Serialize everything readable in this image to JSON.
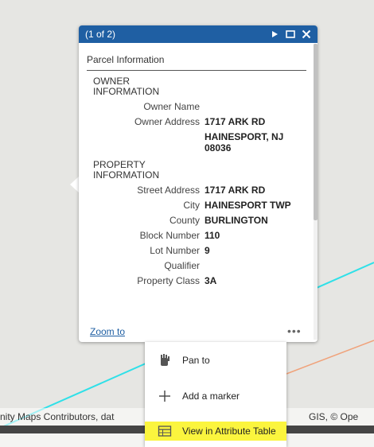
{
  "popup": {
    "counter": "(1 of 2)",
    "title": "Parcel Information",
    "sections": [
      {
        "heading": "OWNER INFORMATION",
        "rows": [
          {
            "label": "Owner Name",
            "value": ""
          },
          {
            "label": "Owner Address",
            "value": "1717 ARK RD"
          },
          {
            "label": "",
            "value": "HAINESPORT, NJ 08036"
          }
        ]
      },
      {
        "heading": "PROPERTY INFORMATION",
        "rows": [
          {
            "label": "Street Address",
            "value": "1717 ARK RD"
          },
          {
            "label": "City",
            "value": "HAINESPORT TWP"
          },
          {
            "label": "County",
            "value": "BURLINGTON"
          },
          {
            "label": "Block Number",
            "value": "110"
          },
          {
            "label": "Lot Number",
            "value": "9"
          },
          {
            "label": "Qualifier",
            "value": ""
          },
          {
            "label": "Property Class",
            "value": "3A"
          }
        ]
      }
    ],
    "zoom_link": "Zoom to",
    "more_label": "•••",
    "buttons": {
      "next": "next-icon",
      "maximize": "maximize-icon",
      "close": "close-icon"
    }
  },
  "action_menu": {
    "items": [
      {
        "label": "Pan to",
        "icon": "pan-icon"
      },
      {
        "label": "Add a marker",
        "icon": "plus-icon"
      },
      {
        "label": "View in Attribute Table",
        "icon": "table-icon"
      }
    ]
  },
  "attribution": {
    "left": "nity Maps Contributors, dat",
    "right": "GIS, © Ope"
  },
  "colors": {
    "header": "#1f5fa3",
    "highlight": "#fbf53e",
    "cyan_line": "#2fe0e8",
    "orange_line": "#f0a27a"
  }
}
